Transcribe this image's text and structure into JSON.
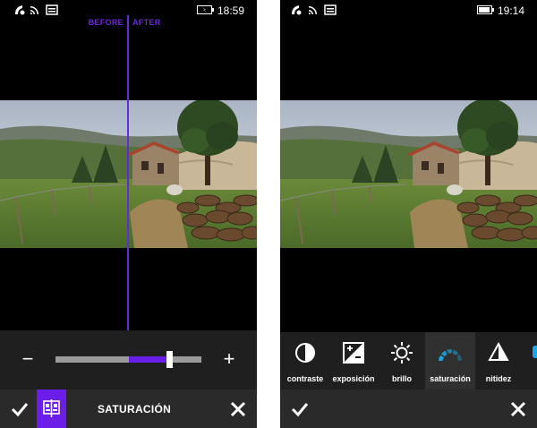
{
  "left_screen": {
    "status": {
      "time": "18:59"
    },
    "compare": {
      "before_label": "BEFORE",
      "after_label": "AFTER"
    },
    "slider": {
      "minus_label": "−",
      "plus_label": "+",
      "value_fraction": 0.78,
      "center_fraction": 0.5
    },
    "app_bar": {
      "tool_title": "SATURACIÓN"
    }
  },
  "right_screen": {
    "status": {
      "time": "19:14"
    },
    "tools": [
      {
        "label": "contraste",
        "icon": "contrast-icon"
      },
      {
        "label": "exposición",
        "icon": "exposure-icon"
      },
      {
        "label": "brillo",
        "icon": "brightness-icon"
      },
      {
        "label": "saturación",
        "icon": "saturation-icon",
        "selected": true
      },
      {
        "label": "nitidez",
        "icon": "sharpness-icon"
      }
    ]
  },
  "colors": {
    "accent": "#6b1ee8",
    "compare_line": "#6b28d6",
    "saturation_icon": "#1ea7e6"
  }
}
